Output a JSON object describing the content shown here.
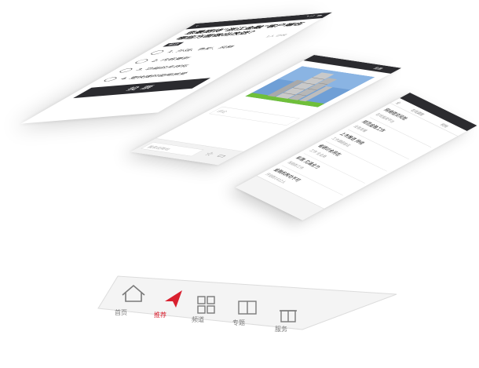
{
  "survey_screen": {
    "back_icon": "chevron-left-icon",
    "status_signal": "•ıl ▬",
    "question": "您最期待\"浙江金融\"客户端在哪些方面做出改进？",
    "tag": "单选",
    "count": "1人 已投",
    "options": [
      {
        "label": "1. 外观、色彩、风格"
      },
      {
        "label": "2. 内容更新"
      },
      {
        "label": "3. 功能的多样化"
      },
      {
        "label": "4. 更快捷的使用感受"
      }
    ],
    "vote_label": "投票"
  },
  "article_screen": {
    "title": "金融",
    "meta": "评论",
    "comment_placeholder": "评论",
    "input_placeholder": "我来说两句",
    "star_icon": "star-icon",
    "book_icon": "book-icon",
    "hero_colors": {
      "sky": "#6f9fd6",
      "grass": "#6fbf3a",
      "tower": "#c9c9c9"
    }
  },
  "list_screen": {
    "tabs": [
      "全",
      "在线调查",
      "机构"
    ],
    "items": [
      {
        "title": "网络借贷风险",
        "sub": "在线投资平台"
      },
      {
        "title": "规范金融工作",
        "sub": "业务发展"
      },
      {
        "title": "上市推进 持续",
        "sub": "工作调研会议"
      },
      {
        "title": "省研讨会将在",
        "sub": "工作 全业务"
      },
      {
        "title": "彩票 见涌全力",
        "sub": "当前的工作"
      },
      {
        "title": "金融机构功不可",
        "sub": "开创的1412人"
      }
    ]
  },
  "bottom_nav": {
    "items": [
      {
        "label": "首页",
        "icon": "home-icon"
      },
      {
        "label": "推荐",
        "icon": "navigate-icon"
      },
      {
        "label": "频道",
        "icon": "grid-icon"
      },
      {
        "label": "专题",
        "icon": "columns-icon"
      },
      {
        "label": "服务",
        "icon": "gift-icon"
      }
    ],
    "active_color": "#d9202f",
    "inactive_color": "#7a7a7a"
  }
}
